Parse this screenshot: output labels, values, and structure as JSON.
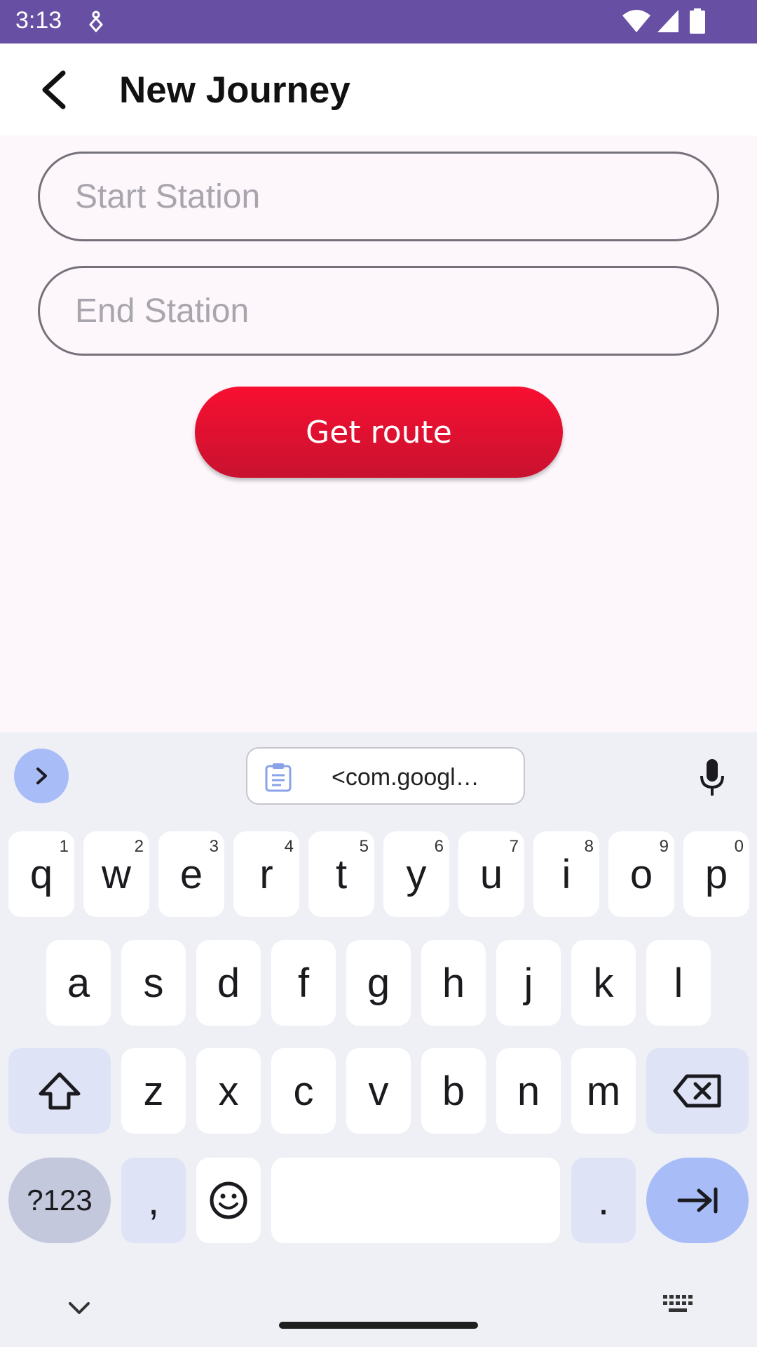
{
  "status_bar": {
    "time": "3:13"
  },
  "app_bar": {
    "title": "New Journey"
  },
  "form": {
    "start_placeholder": "Start Station",
    "end_placeholder": "End Station",
    "get_route_label": "Get route"
  },
  "keyboard": {
    "clipboard_text": "<com.googl…",
    "row1": [
      {
        "key": "q",
        "hint": "1"
      },
      {
        "key": "w",
        "hint": "2"
      },
      {
        "key": "e",
        "hint": "3"
      },
      {
        "key": "r",
        "hint": "4"
      },
      {
        "key": "t",
        "hint": "5"
      },
      {
        "key": "y",
        "hint": "6"
      },
      {
        "key": "u",
        "hint": "7"
      },
      {
        "key": "i",
        "hint": "8"
      },
      {
        "key": "o",
        "hint": "9"
      },
      {
        "key": "p",
        "hint": "0"
      }
    ],
    "row2": [
      "a",
      "s",
      "d",
      "f",
      "g",
      "h",
      "j",
      "k",
      "l"
    ],
    "row3": [
      "z",
      "x",
      "c",
      "v",
      "b",
      "n",
      "m"
    ],
    "symbols_label": "?123",
    "comma": ",",
    "period": "."
  },
  "colors": {
    "status_bar": "#6750a4",
    "button_red": "#f80f30",
    "background": "#fdf7fc"
  },
  "icons": [
    "notification-icon",
    "wifi-icon",
    "signal-icon",
    "battery-icon",
    "back-arrow-icon",
    "chevron-right-icon",
    "clipboard-icon",
    "microphone-icon",
    "shift-icon",
    "backspace-icon",
    "emoji-icon",
    "tab-enter-icon",
    "chevron-down-icon",
    "keyboard-icon"
  ]
}
